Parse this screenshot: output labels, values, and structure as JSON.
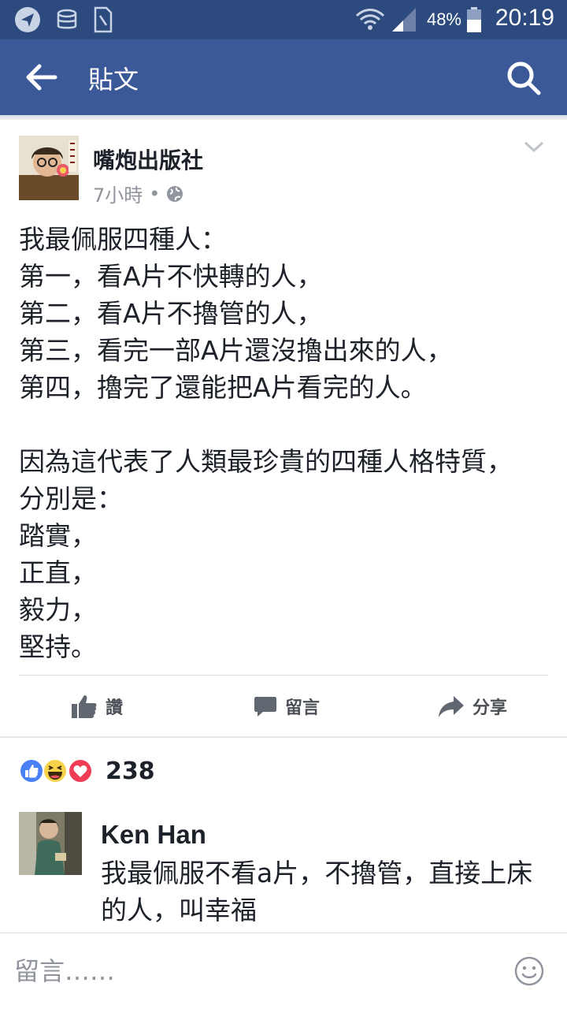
{
  "status_bar": {
    "battery_percent": "48%",
    "time": "20:19"
  },
  "app_bar": {
    "title": "貼文",
    "color": "#3b5998"
  },
  "post": {
    "author": "嘴炮出版社",
    "time_ago": "7小時",
    "separator": "•",
    "privacy_icon": "globe-icon",
    "lines": [
      "我最佩服四種人：",
      "第一，看A片不快轉的人，",
      "第二，看A片不擼管的人，",
      "第三，看完一部A片還沒擼出來的人，",
      "第四，擼完了還能把A片看完的人。",
      "",
      "因為這代表了人類最珍貴的四種人格特質，分別是：",
      "踏實，",
      "正直，",
      "毅力，",
      "堅持。"
    ]
  },
  "actions": {
    "like_label": "讚",
    "comment_label": "留言",
    "share_label": "分享"
  },
  "reactions": {
    "icons": [
      "like-icon",
      "haha-icon",
      "love-icon"
    ],
    "count": "238"
  },
  "comment": {
    "author": "Ken Han",
    "text": "我最佩服不看a片，不擼管，直接上床的人，叫幸福"
  },
  "composer": {
    "placeholder": "留言……"
  }
}
